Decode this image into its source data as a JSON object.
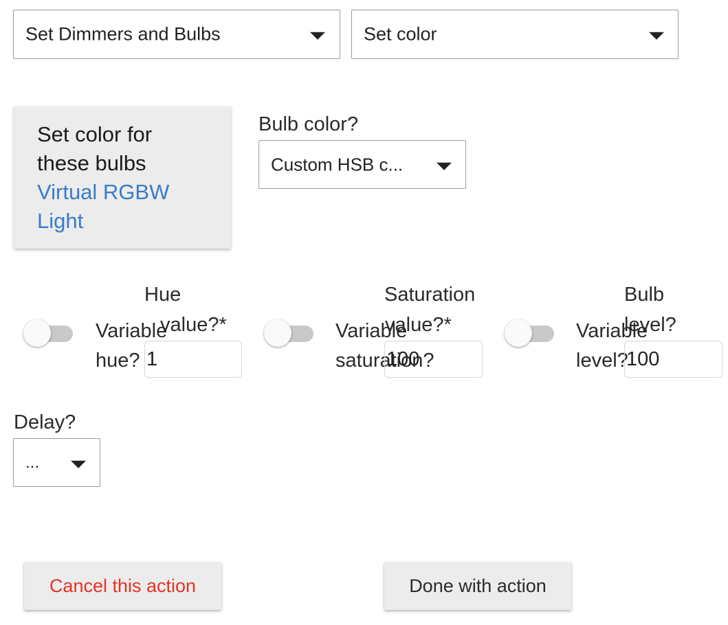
{
  "top_selects": {
    "device_type": "Set Dimmers and Bulbs",
    "action": "Set color"
  },
  "card": {
    "title_line1": "Set color for",
    "title_line2": "these bulbs",
    "device_line1": "Virtual RGBW",
    "device_line2": "Light"
  },
  "bulb_color": {
    "label": "Bulb color?",
    "selected": "Custom HSB c..."
  },
  "hue": {
    "toggle_label_line1": "Variable",
    "toggle_label_line2": "hue?",
    "field_label_line1": "Hue",
    "field_label_line2": "value?*",
    "value": "1"
  },
  "saturation": {
    "toggle_label_line1": "Variable",
    "toggle_label_line2": "saturation?",
    "field_label_line1": "Saturation",
    "field_label_line2": "value?*",
    "value": "100"
  },
  "level": {
    "toggle_label_line1": "Variable",
    "toggle_label_line2": "level?",
    "field_label_line1": "Bulb",
    "field_label_line2": "level?",
    "value": "100"
  },
  "delay": {
    "label": "Delay?",
    "selected": "..."
  },
  "buttons": {
    "cancel": "Cancel this action",
    "done": "Done with action"
  },
  "colors": {
    "link": "#3a7bc8",
    "cancel": "#e53224",
    "card_bg": "#ececec",
    "toggle_track": "#c9c9c9"
  }
}
